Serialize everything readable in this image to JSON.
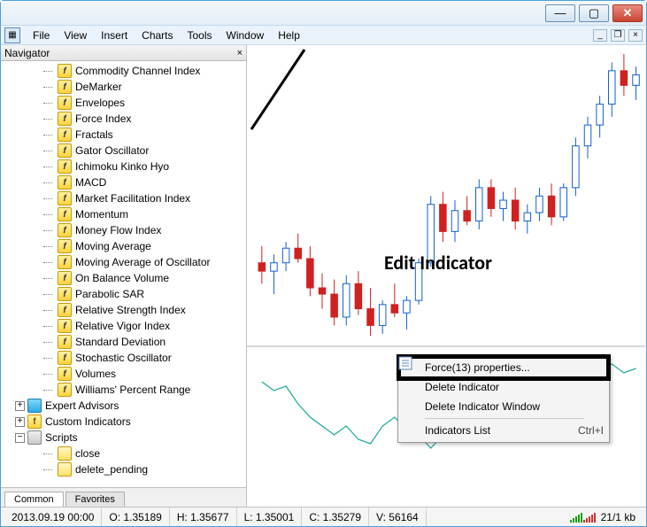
{
  "menubar": {
    "items": [
      "File",
      "View",
      "Insert",
      "Charts",
      "Tools",
      "Window",
      "Help"
    ]
  },
  "navigator": {
    "title": "Navigator",
    "indicators": [
      "Commodity Channel Index",
      "DeMarker",
      "Envelopes",
      "Force Index",
      "Fractals",
      "Gator Oscillator",
      "Ichimoku Kinko Hyo",
      "MACD",
      "Market Facilitation Index",
      "Momentum",
      "Money Flow Index",
      "Moving Average",
      "Moving Average of Oscillator",
      "On Balance Volume",
      "Parabolic SAR",
      "Relative Strength Index",
      "Relative Vigor Index",
      "Standard Deviation",
      "Stochastic Oscillator",
      "Volumes",
      "Williams' Percent Range"
    ],
    "groups": {
      "expert_advisors": "Expert Advisors",
      "custom_indicators": "Custom Indicators",
      "scripts": "Scripts"
    },
    "scripts": [
      "close",
      "delete_pending"
    ],
    "tabs": {
      "common": "Common",
      "favorites": "Favorites"
    }
  },
  "annotation": "Edit Indicator",
  "context_menu": {
    "properties": "Force(13) properties...",
    "delete_indicator": "Delete Indicator",
    "delete_window": "Delete Indicator Window",
    "indicators_list": "Indicators List",
    "indicators_list_shortcut": "Ctrl+I"
  },
  "statusbar": {
    "datetime": "2013.09.19 00:00",
    "o_label": "O:",
    "o": "1.35189",
    "h_label": "H:",
    "h": "1.35677",
    "l_label": "L:",
    "l": "1.35001",
    "c_label": "C:",
    "c": "1.35279",
    "v_label": "V:",
    "v": "56164",
    "net": "21/1 kb"
  },
  "chart_data": {
    "type": "candlestick",
    "main": {
      "ylim": [
        1.348,
        1.362
      ],
      "candles": [
        {
          "o": 1.352,
          "h": 1.3528,
          "l": 1.351,
          "c": 1.3516
        },
        {
          "o": 1.3516,
          "h": 1.3524,
          "l": 1.3505,
          "c": 1.352
        },
        {
          "o": 1.352,
          "h": 1.353,
          "l": 1.3516,
          "c": 1.3527
        },
        {
          "o": 1.3527,
          "h": 1.3534,
          "l": 1.352,
          "c": 1.3522
        },
        {
          "o": 1.3522,
          "h": 1.3528,
          "l": 1.3504,
          "c": 1.3508
        },
        {
          "o": 1.3508,
          "h": 1.3515,
          "l": 1.3498,
          "c": 1.3505
        },
        {
          "o": 1.3505,
          "h": 1.3512,
          "l": 1.349,
          "c": 1.3494
        },
        {
          "o": 1.3494,
          "h": 1.3514,
          "l": 1.349,
          "c": 1.351
        },
        {
          "o": 1.351,
          "h": 1.3516,
          "l": 1.3495,
          "c": 1.3498
        },
        {
          "o": 1.3498,
          "h": 1.3508,
          "l": 1.3485,
          "c": 1.349
        },
        {
          "o": 1.349,
          "h": 1.3502,
          "l": 1.3486,
          "c": 1.35
        },
        {
          "o": 1.35,
          "h": 1.351,
          "l": 1.3494,
          "c": 1.3496
        },
        {
          "o": 1.3496,
          "h": 1.3504,
          "l": 1.3488,
          "c": 1.3502
        },
        {
          "o": 1.3502,
          "h": 1.3522,
          "l": 1.35,
          "c": 1.352
        },
        {
          "o": 1.352,
          "h": 1.3552,
          "l": 1.3518,
          "c": 1.3548
        },
        {
          "o": 1.3548,
          "h": 1.3554,
          "l": 1.353,
          "c": 1.3535
        },
        {
          "o": 1.3535,
          "h": 1.355,
          "l": 1.353,
          "c": 1.3545
        },
        {
          "o": 1.3545,
          "h": 1.3552,
          "l": 1.3538,
          "c": 1.354
        },
        {
          "o": 1.354,
          "h": 1.356,
          "l": 1.3536,
          "c": 1.3556
        },
        {
          "o": 1.3556,
          "h": 1.356,
          "l": 1.3542,
          "c": 1.3546
        },
        {
          "o": 1.3546,
          "h": 1.3554,
          "l": 1.354,
          "c": 1.355
        },
        {
          "o": 1.355,
          "h": 1.3556,
          "l": 1.3536,
          "c": 1.354
        },
        {
          "o": 1.354,
          "h": 1.3548,
          "l": 1.3534,
          "c": 1.3544
        },
        {
          "o": 1.3544,
          "h": 1.3556,
          "l": 1.354,
          "c": 1.3552
        },
        {
          "o": 1.3552,
          "h": 1.3558,
          "l": 1.3538,
          "c": 1.3542
        },
        {
          "o": 1.3542,
          "h": 1.3558,
          "l": 1.354,
          "c": 1.3556
        },
        {
          "o": 1.3556,
          "h": 1.358,
          "l": 1.3552,
          "c": 1.3576
        },
        {
          "o": 1.3576,
          "h": 1.359,
          "l": 1.357,
          "c": 1.3586
        },
        {
          "o": 1.3586,
          "h": 1.36,
          "l": 1.358,
          "c": 1.3596
        },
        {
          "o": 1.3596,
          "h": 1.3616,
          "l": 1.359,
          "c": 1.3612
        },
        {
          "o": 1.3612,
          "h": 1.362,
          "l": 1.36,
          "c": 1.3605
        },
        {
          "o": 1.3605,
          "h": 1.3614,
          "l": 1.3598,
          "c": 1.361
        }
      ]
    },
    "indicator": {
      "name": "Force(13)",
      "ylim": [
        -0.06,
        0.06
      ],
      "values": [
        0.02,
        0.01,
        0.015,
        -0.005,
        -0.02,
        -0.03,
        -0.04,
        -0.03,
        -0.045,
        -0.05,
        -0.03,
        -0.02,
        -0.035,
        -0.04,
        -0.055,
        -0.04,
        -0.03,
        -0.015,
        0.01,
        0.04,
        0.03,
        0.02,
        0.015,
        0.02,
        0.01,
        0.005,
        0.008,
        0.02,
        0.035,
        0.04,
        0.03,
        0.035
      ]
    }
  }
}
